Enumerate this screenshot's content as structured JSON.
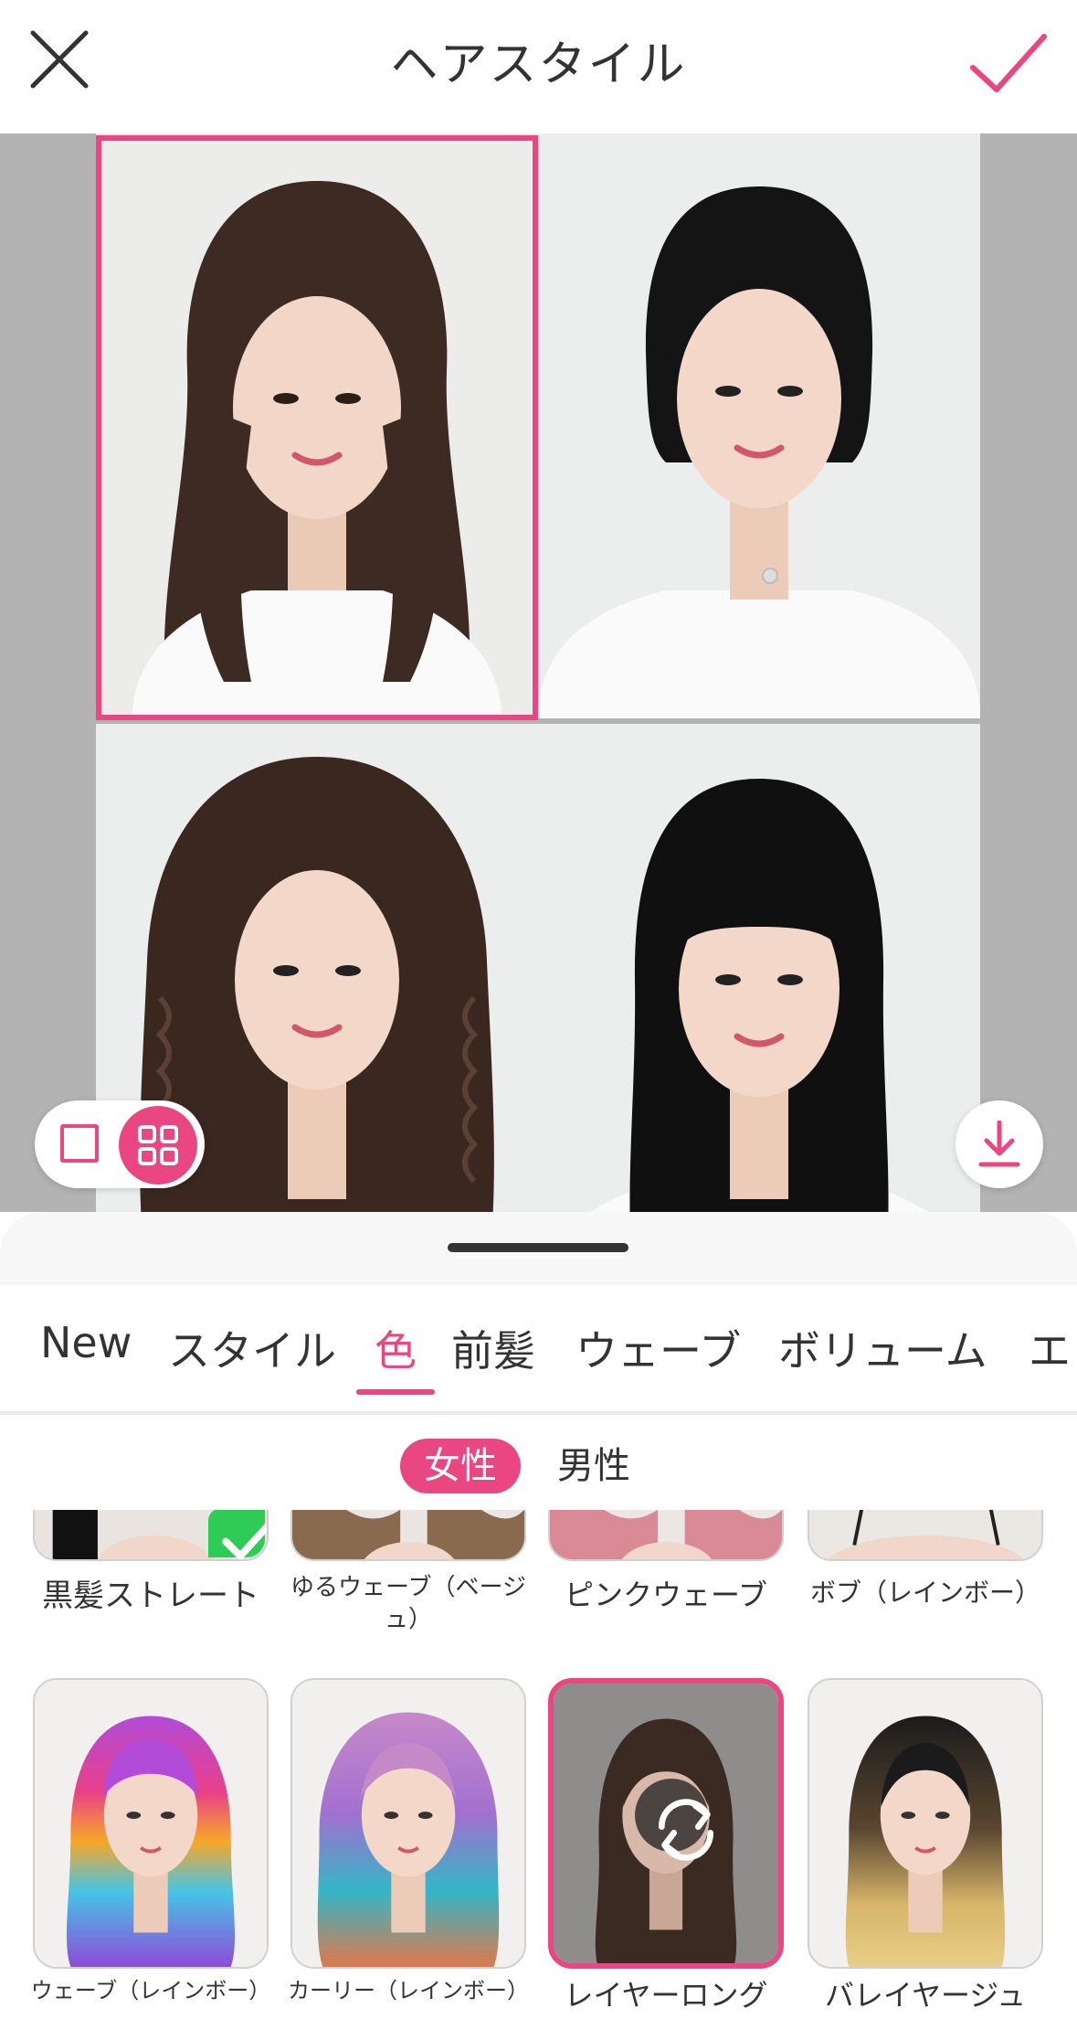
{
  "header": {
    "title": "ヘアスタイル",
    "close_icon": "close-icon",
    "confirm_icon": "checkmark-icon"
  },
  "colors": {
    "accent": "#e94682",
    "check_green": "#2ecc55",
    "preview_bg": "#b3b3b3"
  },
  "preview": {
    "cells": [
      {
        "hair": "long-layered-brown",
        "selected": true
      },
      {
        "hair": "black-bob",
        "selected": false
      },
      {
        "hair": "curly-brown",
        "selected": false
      },
      {
        "hair": "black-long-bangs",
        "selected": false
      }
    ],
    "view_modes": [
      "single-view-icon",
      "grid-view-icon"
    ],
    "active_view": "grid",
    "download_icon": "download-icon"
  },
  "tabs": {
    "items": [
      "New",
      "スタイル",
      "色",
      "前髪",
      "ウェーブ",
      "ボリューム",
      "エ"
    ],
    "active": "色"
  },
  "gender": {
    "female": "女性",
    "male": "男性",
    "active": "女性"
  },
  "styles": {
    "row1": [
      {
        "label": "黒髪ストレート",
        "checked": true
      },
      {
        "label": "ゆるウェーブ（ベージュ）"
      },
      {
        "label": "ピンクウェーブ"
      },
      {
        "label": "ボブ（レインボー）"
      }
    ],
    "row2": [
      {
        "label": "ウェーブ（レインボー）"
      },
      {
        "label": "カーリー（レインボー）"
      },
      {
        "label": "レイヤーロング",
        "selected": true
      },
      {
        "label": "バレイヤージュ"
      }
    ]
  }
}
